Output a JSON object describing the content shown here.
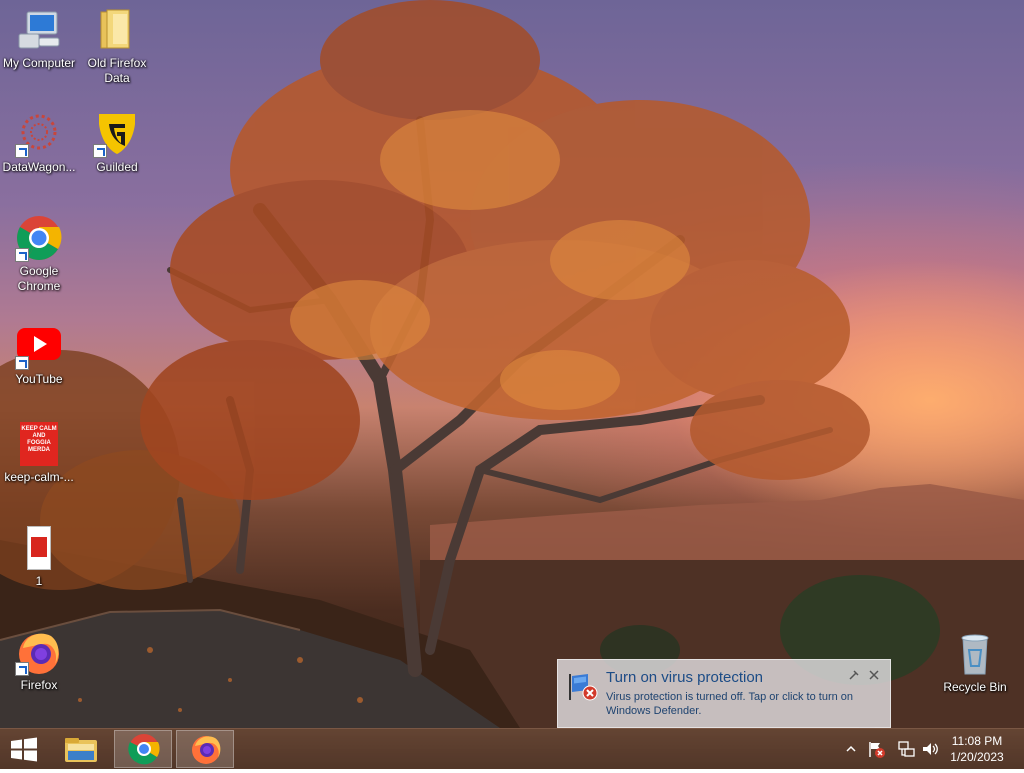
{
  "desktop_icons": [
    {
      "id": "my-computer",
      "label": "My Computer",
      "icon": "computer-icon",
      "shortcut": false
    },
    {
      "id": "old-firefox-data",
      "label": "Old Firefox Data",
      "icon": "folder-icon",
      "shortcut": false
    },
    {
      "id": "datawagon",
      "label": "DataWagon...",
      "icon": "datawagon-icon",
      "shortcut": true
    },
    {
      "id": "guilded",
      "label": "Guilded",
      "icon": "guilded-icon",
      "shortcut": true
    },
    {
      "id": "google-chrome",
      "label": "Google Chrome",
      "icon": "chrome-icon",
      "shortcut": true
    },
    {
      "id": "youtube",
      "label": "YouTube",
      "icon": "youtube-icon",
      "shortcut": true
    },
    {
      "id": "keep-calm",
      "label": "keep-calm-...",
      "icon": "keep-calm-image-icon",
      "shortcut": false
    },
    {
      "id": "file-1",
      "label": "1",
      "icon": "image-file-icon",
      "shortcut": false
    },
    {
      "id": "firefox",
      "label": "Firefox",
      "icon": "firefox-icon",
      "shortcut": true
    },
    {
      "id": "recycle-bin",
      "label": "Recycle Bin",
      "icon": "recycle-bin-icon",
      "shortcut": false
    }
  ],
  "keep_calm_text": "KEEP CALM AND FOGGIA MERDA",
  "notification": {
    "title": "Turn on virus protection",
    "body": "Virus protection is turned off. Tap or click to turn on Windows Defender.",
    "icon": "windows-defender-flag-icon"
  },
  "taskbar": {
    "start": "windows-start-icon",
    "pinned": [
      {
        "id": "file-explorer",
        "icon": "folder-icon",
        "active": false
      },
      {
        "id": "chrome",
        "icon": "chrome-icon",
        "active": true
      },
      {
        "id": "firefox",
        "icon": "firefox-icon",
        "active": true
      }
    ],
    "tray_icons": [
      "show-hidden-icons-chevron",
      "action-center-flag-error-icon",
      "network-icon",
      "volume-icon"
    ]
  },
  "clock": {
    "time": "11:08 PM",
    "date": "1/20/2023"
  },
  "colors": {
    "taskbar": "#5a3a2a",
    "toast_title": "#1c4c86",
    "accent_error": "#d23a2b"
  }
}
